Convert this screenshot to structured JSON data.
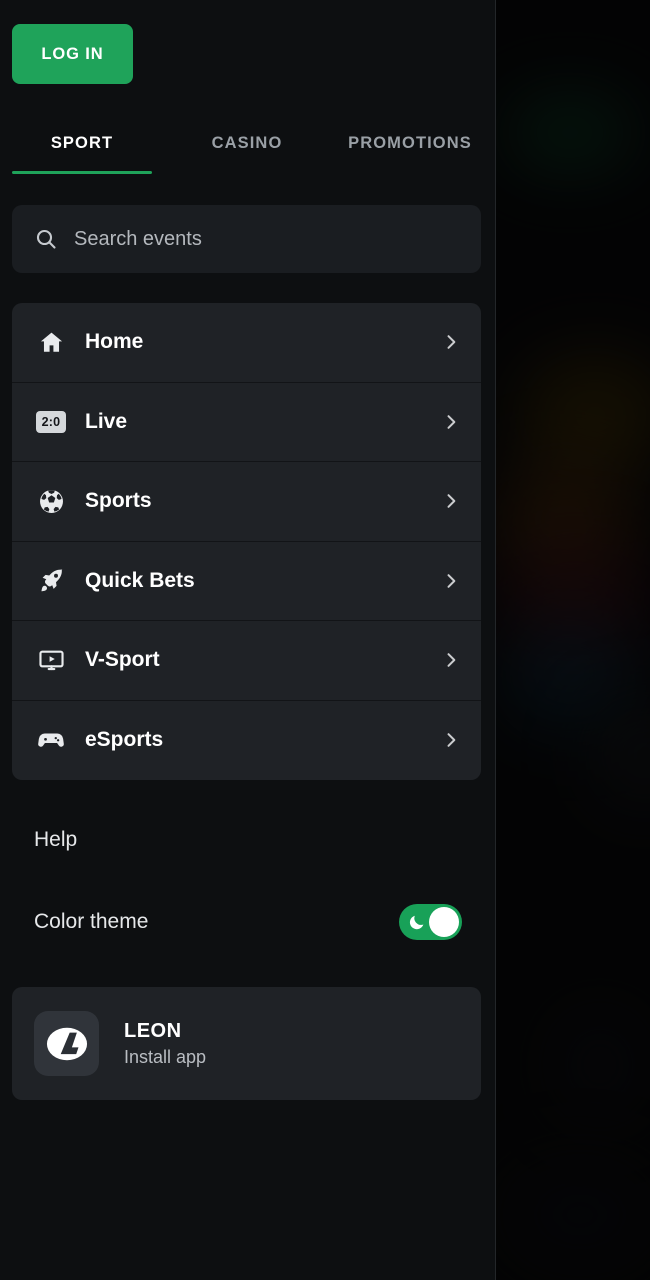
{
  "colors": {
    "accent_green": "#1fa35a",
    "toggle_green": "#18a158",
    "drawer_bg": "#0d0f11",
    "card_bg": "#1f2226",
    "search_bg": "#1a1d21",
    "text_primary": "#ffffff",
    "text_muted": "#9aa0a6"
  },
  "header": {
    "login_label": "LOG IN"
  },
  "tabs": [
    {
      "id": "sport",
      "label": "SPORT",
      "active": true
    },
    {
      "id": "casino",
      "label": "CASINO",
      "active": false
    },
    {
      "id": "promotions",
      "label": "PROMOTIONS",
      "active": false
    }
  ],
  "search": {
    "placeholder": "Search events",
    "value": "",
    "icon": "search-icon"
  },
  "menu": {
    "items": [
      {
        "id": "home",
        "label": "Home",
        "icon": "home-icon",
        "chevron": "chevron-right-icon"
      },
      {
        "id": "live",
        "label": "Live",
        "icon": "score-badge-icon",
        "badge": "2:0",
        "chevron": "chevron-right-icon"
      },
      {
        "id": "sports",
        "label": "Sports",
        "icon": "soccer-ball-icon",
        "chevron": "chevron-right-icon"
      },
      {
        "id": "quick-bets",
        "label": "Quick Bets",
        "icon": "rocket-icon",
        "chevron": "chevron-right-icon"
      },
      {
        "id": "v-sport",
        "label": "V-Sport",
        "icon": "monitor-play-icon",
        "chevron": "chevron-right-icon"
      },
      {
        "id": "esports",
        "label": "eSports",
        "icon": "gamepad-icon",
        "chevron": "chevron-right-icon"
      }
    ]
  },
  "settings": {
    "help_label": "Help",
    "theme_label": "Color theme",
    "theme_enabled": true,
    "theme_icon": "moon-icon"
  },
  "install": {
    "brand": "LEON",
    "action": "Install app",
    "logo": "leon-logo-icon"
  }
}
